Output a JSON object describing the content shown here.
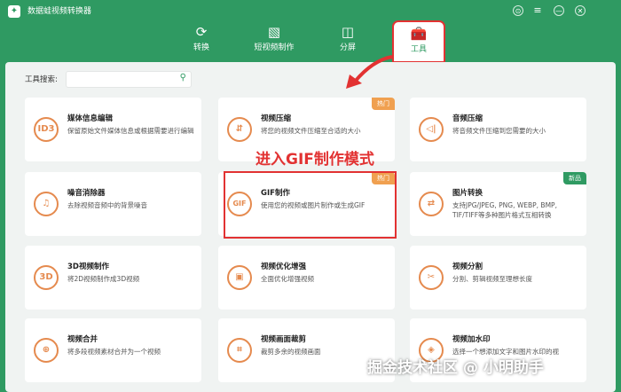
{
  "app": {
    "title": "数据蛙视频转换器"
  },
  "window_controls": [
    "⊙",
    "≡",
    "—",
    "✕"
  ],
  "nav": [
    {
      "label": "转换",
      "icon": "convert-icon"
    },
    {
      "label": "短视频制作",
      "icon": "image-icon"
    },
    {
      "label": "分屏",
      "icon": "split-icon"
    },
    {
      "label": "工具",
      "icon": "toolbox-icon"
    }
  ],
  "search": {
    "label": "工具搜索:",
    "placeholder": ""
  },
  "cards": [
    {
      "title": "媒体信息编辑",
      "desc": "保留原始文件媒体信息或根据需要进行编辑",
      "icon_text": "ID3",
      "badge": ""
    },
    {
      "title": "视频压缩",
      "desc": "将您的视频文件压缩至合适的大小",
      "icon_text": "⇵",
      "badge": "热门"
    },
    {
      "title": "音频压缩",
      "desc": "将音频文件压缩到您需要的大小",
      "icon_text": "◁|",
      "badge": ""
    },
    {
      "title": "噪音消除器",
      "desc": "去除视频音频中的背景噪音",
      "icon_text": "♫",
      "badge": ""
    },
    {
      "title": "GIF制作",
      "desc": "使用您的视频或图片制作或生成GIF",
      "icon_text": "GIF",
      "badge": "热门"
    },
    {
      "title": "图片转换",
      "desc": "支持JPG/JPEG, PNG, WEBP, BMP, TIF/TIFF等多种图片格式互相转换",
      "icon_text": "⇄",
      "badge": "新品"
    },
    {
      "title": "3D视频制作",
      "desc": "将2D视频制作成3D视频",
      "icon_text": "3D",
      "badge": ""
    },
    {
      "title": "视频优化增强",
      "desc": "全面优化增强视频",
      "icon_text": "▣",
      "badge": ""
    },
    {
      "title": "视频分割",
      "desc": "分割、剪辑视频至理想长度",
      "icon_text": "✂",
      "badge": ""
    },
    {
      "title": "视频合并",
      "desc": "将多段视频素材合并为一个视频",
      "icon_text": "⊕",
      "badge": ""
    },
    {
      "title": "视频画面裁剪",
      "desc": "裁剪多余的视频画面",
      "icon_text": "⌗",
      "badge": ""
    },
    {
      "title": "视频加水印",
      "desc": "选择一个想添加文字和图片水印的视",
      "icon_text": "◈",
      "badge": ""
    }
  ],
  "annotation": "进入GIF制作模式",
  "watermark": "掘金技术社区 @ 小明助手"
}
